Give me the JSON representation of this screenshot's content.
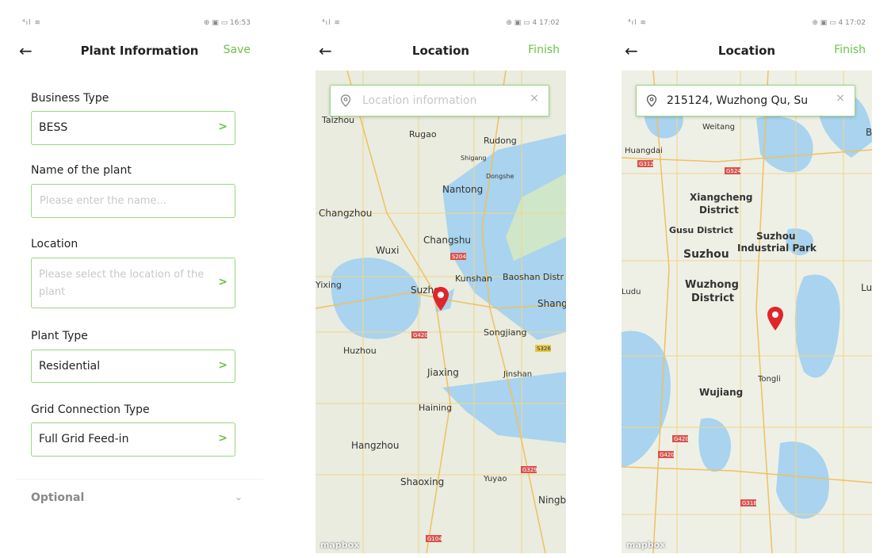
{
  "screen1": {
    "status_signal": "⁴ıl ≋",
    "status_right": "⊕ ▣ ▭ 16:53",
    "back_icon": "arrow-left",
    "title": "Plant Information",
    "save_label": "Save",
    "accent_color": "#6cc24a",
    "business_type": {
      "label": "Business Type",
      "value": "BESS"
    },
    "plant_name": {
      "label": "Name of the plant",
      "placeholder": "Please enter the name...",
      "value": ""
    },
    "location": {
      "label": "Location",
      "placeholder": "Please select the location of the plant"
    },
    "plant_type": {
      "label": "Plant Type",
      "value": "Residential"
    },
    "grid_connection": {
      "label": "Grid Connection Type",
      "value": "Full Grid Feed-in"
    },
    "optional_label": "Optional",
    "chevron_icon": "chevron-right"
  },
  "screen2": {
    "status_signal": "⁴ıl ≋",
    "status_right": "⊕ ▣ ▭ 4 17:02",
    "title": "Location",
    "finish_label": "Finish",
    "search_placeholder": "Location information",
    "map_attribution": "mapbox",
    "map_labels": [
      "Taizhou",
      "Rugao",
      "Rudong",
      "Shigang",
      "Dongshe",
      "Nantong",
      "Changzhou",
      "Changshu",
      "Wuxi",
      "Yixing",
      "Suzhou",
      "Kunshan",
      "Baoshan Distr",
      "Shang",
      "Songjiang",
      "Huzhou",
      "Jiaxing",
      "Jinshan",
      "Haining",
      "Hangzhou",
      "Shaoxing",
      "Yuyao",
      "Ningb"
    ],
    "road_shields": [
      "S204",
      "G420",
      "S326",
      "G329",
      "G104"
    ]
  },
  "screen3": {
    "status_signal": "⁴ıl ≋",
    "status_right": "⊕ ▣ ▭ 4 17:02",
    "title": "Location",
    "finish_label": "Finish",
    "search_value": "215124, Wuzhong Qu, Su",
    "map_attribution": "mapbox",
    "map_labels": [
      "Weitang",
      "Huangdai",
      "Xiangcheng",
      "District",
      "Gusu District",
      "Suzhou",
      "Suzhou",
      "Industrial Park",
      "Wuzhong",
      "District",
      "Wujiang",
      "Tongli",
      "Ludu",
      "Lu",
      "B"
    ],
    "road_shields": [
      "G312",
      "G524",
      "G420",
      "G420",
      "G318"
    ]
  }
}
